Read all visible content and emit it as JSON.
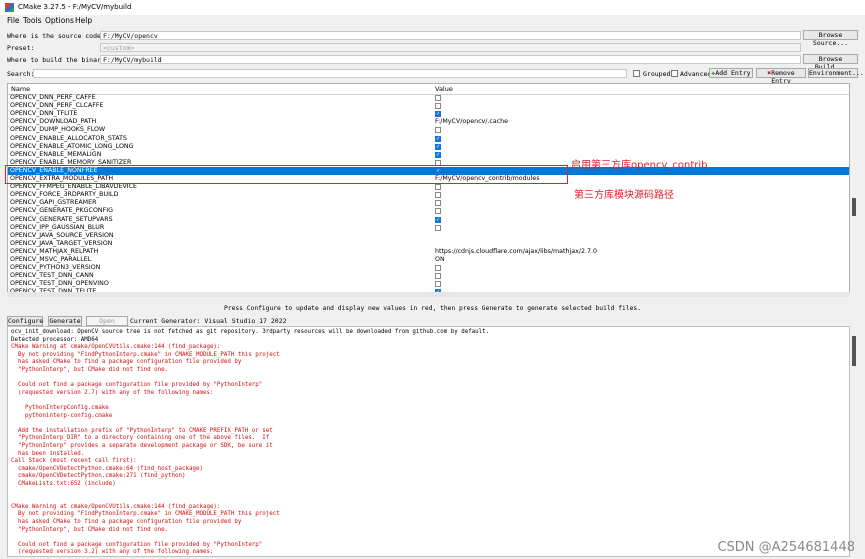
{
  "window": {
    "title": "CMake 3.27.5 - F:/MyCV/mybuild"
  },
  "menu": [
    "File",
    "Tools",
    "Options",
    "Help"
  ],
  "source": {
    "label": "Where is the source code:",
    "value": "F:/MyCV/opencv",
    "button": "Browse Source..."
  },
  "preset": {
    "label": "Preset:",
    "value": "<custom>"
  },
  "binaries": {
    "label": "Where to build the binaries:",
    "value": "F:/MyCV/mybuild",
    "button": "Browse Build..."
  },
  "search": {
    "label": "Search:",
    "grouped": "Grouped",
    "advanced": "Advanced",
    "add_entry": "Add Entry",
    "remove_entry": "Remove Entry",
    "environment": "Environment..."
  },
  "table": {
    "headers": {
      "name": "Name",
      "value": "Value"
    },
    "rows": [
      {
        "name": "OPENCV_DNN_PERF_CAFFE",
        "type": "check",
        "checked": false
      },
      {
        "name": "OPENCV_DNN_PERF_CLCAFFE",
        "type": "check",
        "checked": false
      },
      {
        "name": "OPENCV_DNN_TFLITE",
        "type": "check",
        "checked": true
      },
      {
        "name": "OPENCV_DOWNLOAD_PATH",
        "type": "text",
        "value": "F:/MyCV/opencv/.cache"
      },
      {
        "name": "OPENCV_DUMP_HOOKS_FLOW",
        "type": "check",
        "checked": false
      },
      {
        "name": "OPENCV_ENABLE_ALLOCATOR_STATS",
        "type": "check",
        "checked": true
      },
      {
        "name": "OPENCV_ENABLE_ATOMIC_LONG_LONG",
        "type": "check",
        "checked": true
      },
      {
        "name": "OPENCV_ENABLE_MEMALIGN",
        "type": "check",
        "checked": true
      },
      {
        "name": "OPENCV_ENABLE_MEMORY_SANITIZER",
        "type": "check",
        "checked": false
      },
      {
        "name": "OPENCV_ENABLE_NONFREE",
        "type": "check",
        "checked": true,
        "selected": true
      },
      {
        "name": "OPENCV_EXTRA_MODULES_PATH",
        "type": "text",
        "value": "F:/MyCV/opencv_contrib/modules"
      },
      {
        "name": "OPENCV_FFMPEG_ENABLE_LIBAVDEVICE",
        "type": "check",
        "checked": false
      },
      {
        "name": "OPENCV_FORCE_3RDPARTY_BUILD",
        "type": "check",
        "checked": false
      },
      {
        "name": "OPENCV_GAPI_GSTREAMER",
        "type": "check",
        "checked": false
      },
      {
        "name": "OPENCV_GENERATE_PKGCONFIG",
        "type": "check",
        "checked": false
      },
      {
        "name": "OPENCV_GENERATE_SETUPVARS",
        "type": "check",
        "checked": true
      },
      {
        "name": "OPENCV_IPP_GAUSSIAN_BLUR",
        "type": "check",
        "checked": false
      },
      {
        "name": "OPENCV_JAVA_SOURCE_VERSION",
        "type": "text",
        "value": ""
      },
      {
        "name": "OPENCV_JAVA_TARGET_VERSION",
        "type": "text",
        "value": ""
      },
      {
        "name": "OPENCV_MATHJAX_RELPATH",
        "type": "text",
        "value": "https://cdnjs.cloudflare.com/ajax/libs/mathjax/2.7.0"
      },
      {
        "name": "OPENCV_MSVC_PARALLEL",
        "type": "text",
        "value": "ON"
      },
      {
        "name": "OPENCV_PYTHON3_VERSION",
        "type": "check",
        "checked": false
      },
      {
        "name": "OPENCV_TEST_DNN_CANN",
        "type": "check",
        "checked": false
      },
      {
        "name": "OPENCV_TEST_DNN_OPENVINO",
        "type": "check",
        "checked": false
      },
      {
        "name": "OPENCV_TEST_DNN_TFLITE",
        "type": "check",
        "checked": true
      }
    ]
  },
  "annotations": {
    "enable": "启用第三方库opencv_contrib",
    "path": "第三方库模块源码路径"
  },
  "status": "Press Configure to update and display new values in red, then press Generate to generate selected build files.",
  "actions": {
    "configure": "Configure",
    "generate": "Generate",
    "open_project": "Open Project",
    "generator": "Current Generator: Visual Studio 17 2022"
  },
  "log": [
    {
      "t": "ocv_init_download: OpenCV source tree is not fetched as git repository. 3rdparty resources will be downloaded from github.com by default.",
      "red": false
    },
    {
      "t": "Detected processor: AMD64",
      "red": false
    },
    {
      "t": "CMake Warning at cmake/OpenCVUtils.cmake:144 (find_package):",
      "red": true
    },
    {
      "t": "  By not providing \"FindPythonInterp.cmake\" in CMAKE_MODULE_PATH this project",
      "red": true
    },
    {
      "t": "  has asked CMake to find a package configuration file provided by",
      "red": true
    },
    {
      "t": "  \"PythonInterp\", but CMake did not find one.",
      "red": true
    },
    {
      "t": "",
      "red": true
    },
    {
      "t": "  Could not find a package configuration file provided by \"PythonInterp\"",
      "red": true
    },
    {
      "t": "  (requested version 2.7) with any of the following names:",
      "red": true
    },
    {
      "t": "",
      "red": true
    },
    {
      "t": "    PythonInterpConfig.cmake",
      "red": true
    },
    {
      "t": "    pythoninterp-config.cmake",
      "red": true
    },
    {
      "t": "",
      "red": true
    },
    {
      "t": "  Add the installation prefix of \"PythonInterp\" to CMAKE_PREFIX_PATH or set",
      "red": true
    },
    {
      "t": "  \"PythonInterp_DIR\" to a directory containing one of the above files.  If",
      "red": true
    },
    {
      "t": "  \"PythonInterp\" provides a separate development package or SDK, be sure it",
      "red": true
    },
    {
      "t": "  has been installed.",
      "red": true
    },
    {
      "t": "Call Stack (most recent call first):",
      "red": true
    },
    {
      "t": "  cmake/OpenCVDetectPython.cmake:64 (find_host_package)",
      "red": true
    },
    {
      "t": "  cmake/OpenCVDetectPython.cmake:271 (find_python)",
      "red": true
    },
    {
      "t": "  CMakeLists.txt:652 (include)",
      "red": true
    },
    {
      "t": "",
      "red": true
    },
    {
      "t": "",
      "red": true
    },
    {
      "t": "CMake Warning at cmake/OpenCVUtils.cmake:144 (find_package):",
      "red": true
    },
    {
      "t": "  By not providing \"FindPythonInterp.cmake\" in CMAKE_MODULE_PATH this project",
      "red": true
    },
    {
      "t": "  has asked CMake to find a package configuration file provided by",
      "red": true
    },
    {
      "t": "  \"PythonInterp\", but CMake did not find one.",
      "red": true
    },
    {
      "t": "",
      "red": true
    },
    {
      "t": "  Could not find a package configuration file provided by \"PythonInterp\"",
      "red": true
    },
    {
      "t": "  (requested version 3.2) with any of the following names:",
      "red": true
    }
  ],
  "watermark": "CSDN @A254681448",
  "colors": {
    "selection": "#0078d7",
    "annotation": "#e0202a",
    "log_warning": "#d01010"
  }
}
